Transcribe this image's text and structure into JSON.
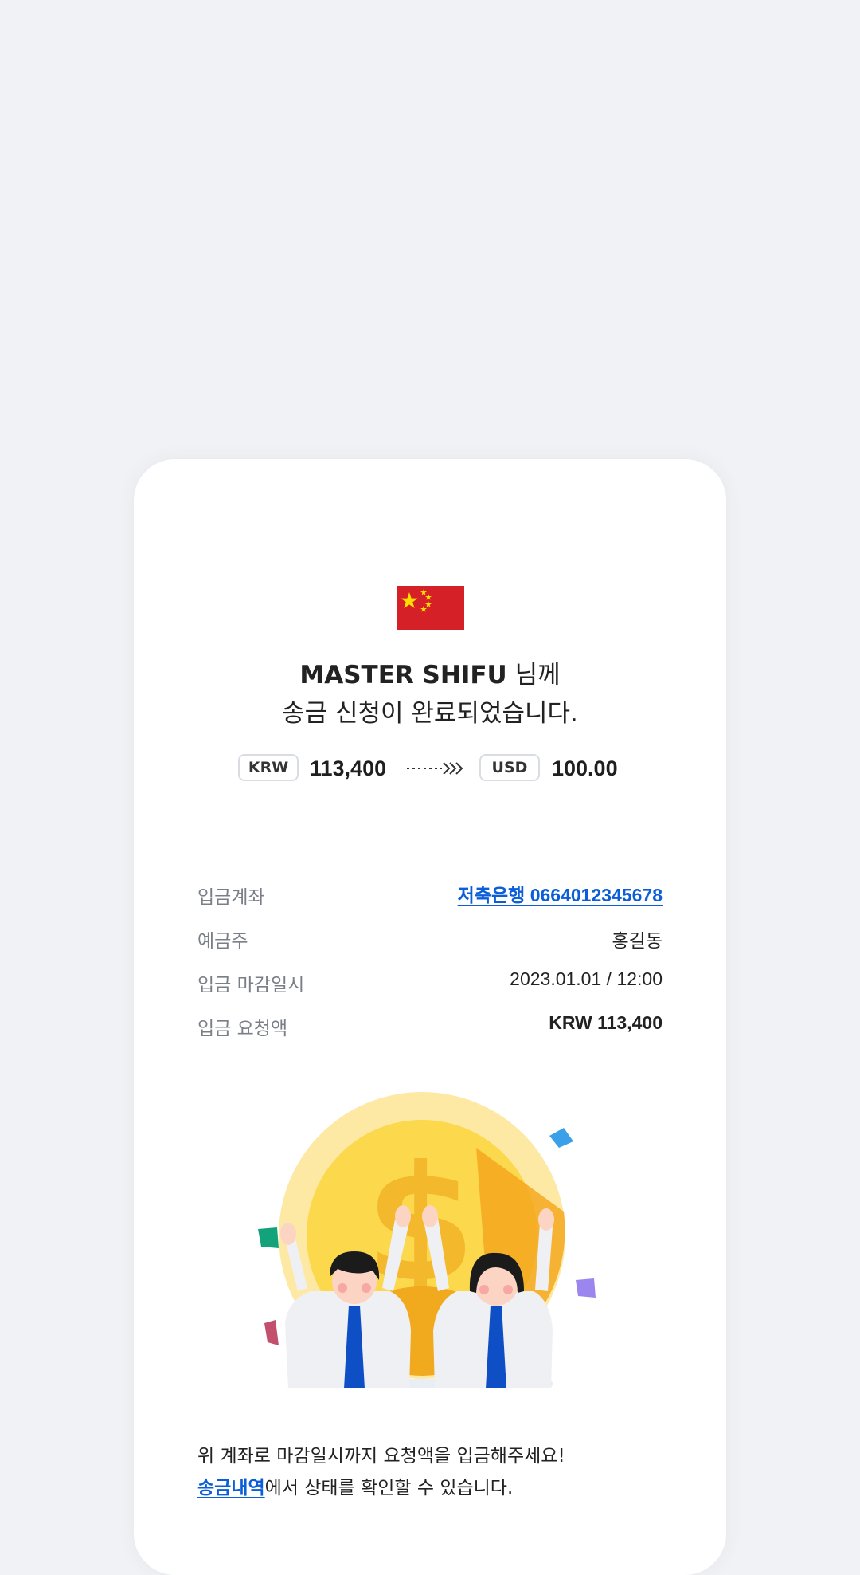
{
  "country_flag": "china-flag",
  "header": {
    "recipient_name": "MASTER SHIFU",
    "recipient_suffix": "님께",
    "completion_message": "송금 신청이 완료되었습니다."
  },
  "exchange": {
    "from_currency": "KRW",
    "from_amount": "113,400",
    "to_currency": "USD",
    "to_amount": "100.00"
  },
  "details": [
    {
      "label": "입금계좌",
      "value": "저축은행 0664012345678"
    },
    {
      "label": "예금주",
      "value": "홍길동"
    },
    {
      "label": "입금 마감일시",
      "value": "2023.01.01 / 12:00"
    },
    {
      "label": "입금 요청액",
      "value": "KRW 113,400"
    }
  ],
  "notice": {
    "line1": "위 계좌로 마감일시까지 요청액을 입금해주세요!",
    "history_link": "송금내역",
    "line2_rest": "에서 상태를 확인할 수 있습니다."
  },
  "colors": {
    "background": "#f0f2f5",
    "card": "#ffffff",
    "link": "#0b5ed7",
    "flag_red": "#d52027",
    "flag_star": "#ffde00"
  }
}
